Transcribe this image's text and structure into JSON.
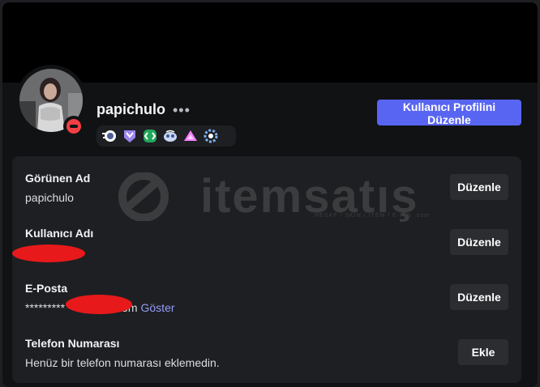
{
  "profile": {
    "username": "papichulo",
    "more_label": "•••",
    "status": "dnd",
    "edit_profile_label": "Kullanıcı Profilini Düzenle",
    "badges": [
      "nitro-badge",
      "hypesquad-badge",
      "active-developer-badge",
      "bug-hunter-badge",
      "early-supporter-badge",
      "quest-badge"
    ]
  },
  "fields": [
    {
      "label": "Görünen Ad",
      "value": "papichulo",
      "action": "Düzenle"
    },
    {
      "label": "Kullanıcı Adı",
      "value": "",
      "action": "Düzenle"
    },
    {
      "label": "E-Posta",
      "value_prefix": "*********",
      "value_suffix": "om",
      "reveal": "Göster",
      "action": "Düzenle"
    },
    {
      "label": "Telefon Numarası",
      "value": "Henüz bir telefon numarası eklemedin.",
      "action": "Ekle"
    }
  ],
  "watermark": {
    "brand": "itemsatış",
    "tagline": "HESAP / SKIN / ITEM / E-PIN .com"
  },
  "colors": {
    "accent": "#5865f2",
    "card": "#1e1f22",
    "background": "#111214",
    "dnd": "#f23f43",
    "link": "#949cf7"
  }
}
